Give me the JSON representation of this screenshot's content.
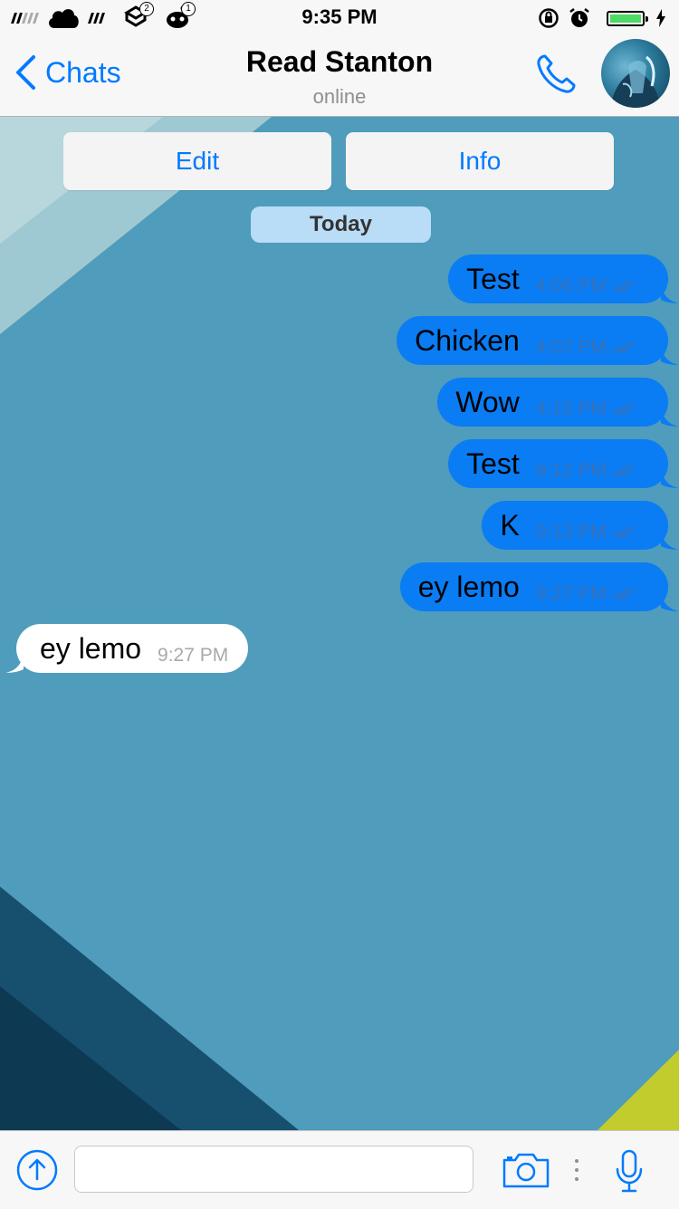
{
  "status_bar": {
    "time": "9:35 PM",
    "notification_badges": [
      "2",
      "1"
    ],
    "battery_color": "#4cd964"
  },
  "nav": {
    "back_label": "Chats",
    "title": "Read Stanton",
    "subtitle": "online",
    "accent_color": "#007aff"
  },
  "actions": {
    "edit_label": "Edit",
    "info_label": "Info"
  },
  "date_separator": "Today",
  "messages": [
    {
      "direction": "out",
      "text": "Test",
      "time": "4:06 PM",
      "status": "read"
    },
    {
      "direction": "out",
      "text": "Chicken",
      "time": "4:07 PM",
      "status": "read"
    },
    {
      "direction": "out",
      "text": "Wow",
      "time": "4:15 PM",
      "status": "read"
    },
    {
      "direction": "out",
      "text": "Test",
      "time": "9:12 PM",
      "status": "read"
    },
    {
      "direction": "out",
      "text": "K",
      "time": "9:13 PM",
      "status": "read"
    },
    {
      "direction": "out",
      "text": "ey lemo",
      "time": "9:27 PM",
      "status": "read"
    },
    {
      "direction": "in",
      "text": "ey lemo",
      "time": "9:27 PM"
    }
  ],
  "input": {
    "value": "",
    "placeholder": ""
  },
  "colors": {
    "outgoing_bubble": "#0a7cf4",
    "incoming_bubble": "#ffffff",
    "chat_background": "#4f9cbc"
  }
}
